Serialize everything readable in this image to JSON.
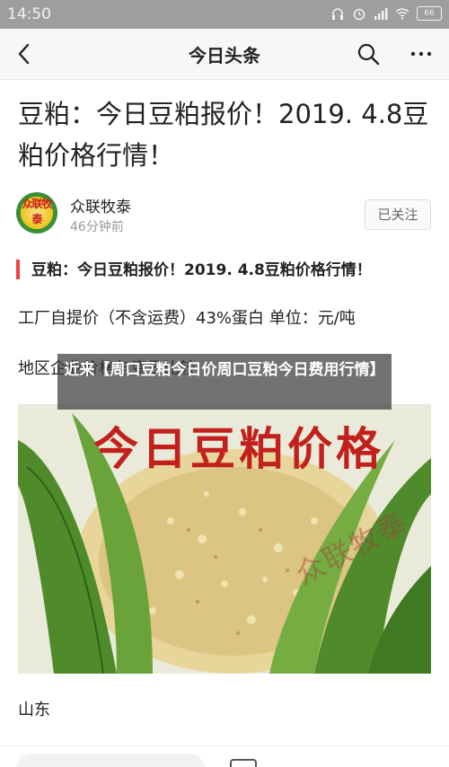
{
  "status_bar": {
    "time": "14:50",
    "battery": "66"
  },
  "nav": {
    "title": "今日头条"
  },
  "article": {
    "title": "豆粕：今日豆粕报价！2019. 4.8豆粕价格行情！",
    "author": {
      "name": "众联牧泰",
      "time": "46分钟前",
      "avatar_text": "众联牧泰",
      "follow_label": "已关注"
    },
    "section_heading": "豆粕：今日豆粕报价！2019. 4.8豆粕价格行情！",
    "para1": "工厂自提价（不含运费）43%蛋白 单位：元/吨",
    "para2": "地区企业价格与变日比较",
    "overlay": "近来【周口豆粕今日价周口豆粕今日费用行情】",
    "image": {
      "banner": "今日豆粕价格",
      "watermark": "众联牧泰"
    },
    "para3": "山东"
  },
  "colors": {
    "accent_red": "#f04142",
    "status_bar": "#9e9e9e",
    "banner_red": "#c2201c"
  }
}
